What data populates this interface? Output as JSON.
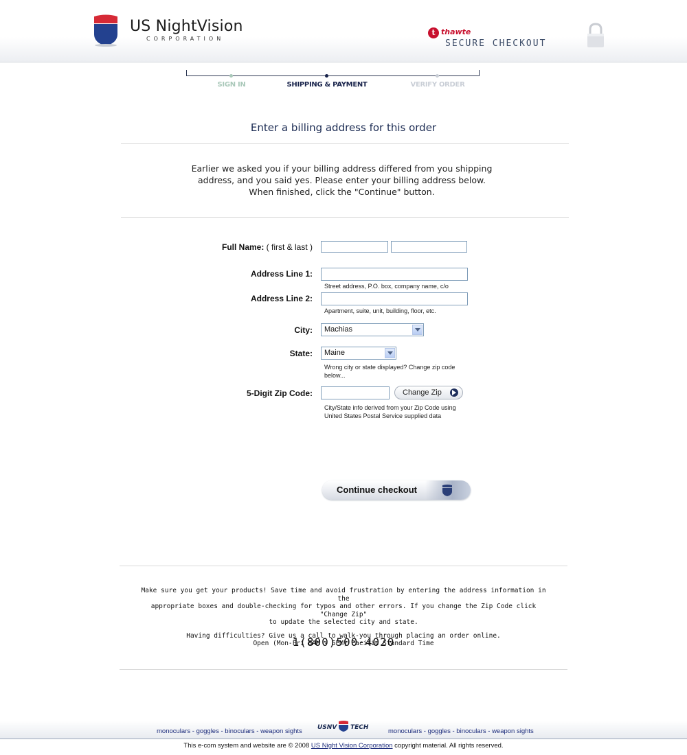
{
  "header": {
    "brand_name": "US NightVision",
    "brand_sub": "CORPORATION",
    "seal_name": "thawte",
    "seal_mark": "t",
    "secure_text": "SECURE CHECKOUT"
  },
  "progress": {
    "steps": [
      {
        "label": "SIGN IN",
        "color": "#a9c8b9"
      },
      {
        "label": "SHIPPING & PAYMENT",
        "color": "#17224a"
      },
      {
        "label": "VERIFY ORDER",
        "color": "#c9ced6"
      }
    ]
  },
  "page": {
    "title": "Enter a billing address for this order",
    "intro_line1": "Earlier we asked you if your billing address differed from you shipping",
    "intro_line2": "address, and you said yes. Please enter your billing address below.",
    "intro_line3": "When finished, click the \"Continue\" button."
  },
  "form": {
    "full_name_label": "Full Name:",
    "full_name_sub": " ( first & last )",
    "first_name_value": "",
    "last_name_value": "",
    "address1_label": "Address Line 1:",
    "address1_value": "",
    "address1_hint": "Street address, P.O. box, company name, c/o",
    "address2_label": "Address Line 2:",
    "address2_value": "",
    "address2_hint": "Apartment, suite, unit, building, floor, etc.",
    "city_label": "City:",
    "city_value": "Machias",
    "state_label": "State:",
    "state_value": "Maine",
    "state_hint_line1": "Wrong city or state displayed? Change zip code",
    "state_hint_line2": "below...",
    "zip_label": "5-Digit Zip Code:",
    "zip_value": "",
    "change_zip_label": "Change Zip",
    "zip_hint_line1": "City/State info derived from your Zip Code using",
    "zip_hint_line2": "United States Postal Service supplied data",
    "continue_label": "Continue checkout"
  },
  "notice": {
    "line1": "Make sure you get your products! Save time and avoid frustration by entering the address information in the",
    "line2": "appropriate boxes and double-checking for typos and other errors. If you change the Zip Code click \"Change Zip\"",
    "line3": "to update the selected city and state.",
    "line4": "Having difficulties? Give us a call to walk-you through placing an order online.",
    "line5": "Open (Mon-Fri 8AM - 5PM) Pacific Standard Time",
    "phone": "1(800)500-4020"
  },
  "footer": {
    "links": [
      "monoculars",
      "goggles",
      "binoculars",
      "weapon sights"
    ],
    "sep": " - ",
    "logo_text_left": "USNV",
    "logo_text_right": "TECH",
    "copyright_pre": "This e-com system and website are © 2008 ",
    "copyright_link": "US Night Vision Corporation",
    "copyright_post": " copyright material. All rights reserved."
  },
  "colors": {
    "navy": "#1a2a52",
    "brand_red": "#d62a36",
    "brand_blue": "#23418f"
  }
}
